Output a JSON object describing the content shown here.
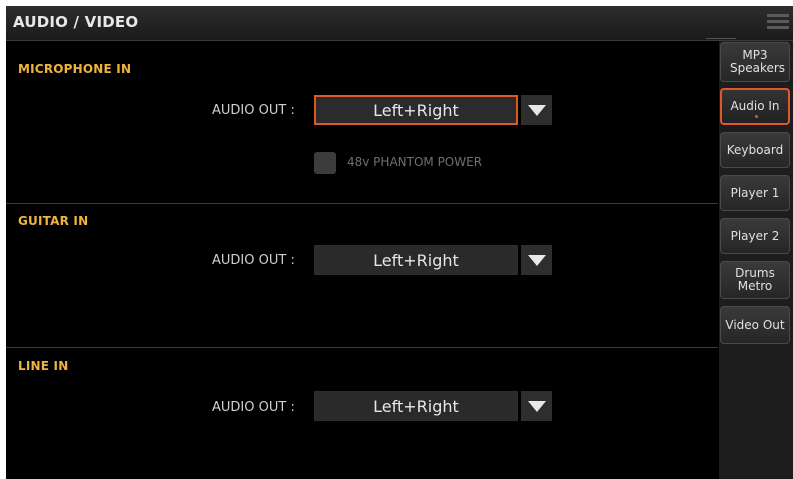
{
  "header": {
    "title": "AUDIO / VIDEO",
    "menu_icon": "menu-icon"
  },
  "sections": [
    {
      "label": "MICROPHONE IN",
      "audio_out_label": "AUDIO OUT :",
      "audio_out_value": "Left+Right",
      "phantom_power_label": "48v PHANTOM POWER",
      "phantom_power_checked": false
    },
    {
      "label": "GUITAR IN",
      "audio_out_label": "AUDIO OUT :",
      "audio_out_value": "Left+Right"
    },
    {
      "label": "LINE IN",
      "audio_out_label": "AUDIO OUT :",
      "audio_out_value": "Left+Right"
    }
  ],
  "tabs": [
    {
      "label": "MP3 Speakers"
    },
    {
      "label": "Audio In",
      "active": true
    },
    {
      "label": "Keyboard"
    },
    {
      "label": "Player 1"
    },
    {
      "label": "Player 2"
    },
    {
      "label": "Drums Metro"
    },
    {
      "label": "Video Out"
    }
  ],
  "colors": {
    "accent": "#e0572a",
    "section_label": "#f0b43c",
    "background": "#000000"
  }
}
